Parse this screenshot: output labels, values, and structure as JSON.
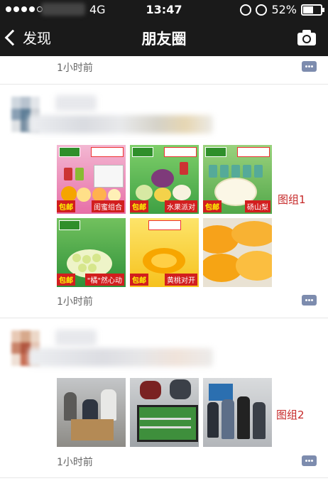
{
  "status": {
    "network": "4G",
    "time": "13:47",
    "battery": "52%",
    "battery_level": 0.52
  },
  "nav": {
    "back_label": "发现",
    "title": "朋友圈"
  },
  "posts": [
    {
      "time": "1小时前"
    },
    {
      "time": "1小时前",
      "group_label": "图组1",
      "tiles": [
        {
          "tag": "包邮",
          "name": "闺蜜组合"
        },
        {
          "tag": "包邮",
          "name": "水果派对"
        },
        {
          "tag": "包邮",
          "name": "砀山梨"
        },
        {
          "tag": "包邮",
          "name": "\"橘\"然心动"
        },
        {
          "tag": "包邮",
          "name": "黄桃对开"
        },
        {
          "tag": "",
          "name": ""
        }
      ]
    },
    {
      "time": "1小时前",
      "group_label": "图组2"
    }
  ],
  "colors": {
    "topbar": "#1a1a1a",
    "link_blue": "#7d8cae",
    "label_red": "#c62828"
  }
}
